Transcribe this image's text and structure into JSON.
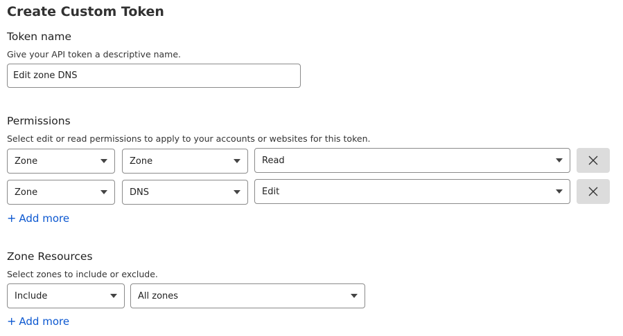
{
  "page_title": "Create Custom Token",
  "token_name": {
    "label": "Token name",
    "help": "Give your API token a descriptive name.",
    "value": "Edit zone DNS"
  },
  "permissions": {
    "label": "Permissions",
    "help": "Select edit or read permissions to apply to your accounts or websites for this token.",
    "rows": [
      {
        "scope": "Zone",
        "resource": "Zone",
        "access": "Read"
      },
      {
        "scope": "Zone",
        "resource": "DNS",
        "access": "Edit"
      }
    ],
    "add_more": "Add more"
  },
  "zone_resources": {
    "label": "Zone Resources",
    "help": "Select zones to include or exclude.",
    "mode": "Include",
    "zones": "All zones",
    "add_more": "Add more"
  },
  "icons": {
    "remove": "close-icon",
    "dropdown": "chevron-down-icon",
    "add": "plus-icon"
  },
  "colors": {
    "link": "#0b57d0",
    "remove_bg": "#dcdcdc"
  }
}
